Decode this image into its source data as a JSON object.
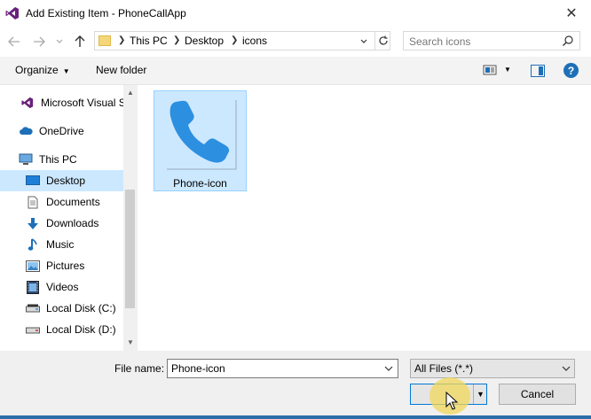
{
  "window": {
    "title": "Add Existing Item - PhoneCallApp",
    "close_glyph": "✕"
  },
  "address": {
    "crumbs": [
      "This PC",
      "Desktop",
      "icons"
    ],
    "search_placeholder": "Search icons"
  },
  "toolbar": {
    "organize_label": "Organize",
    "new_folder_label": "New folder",
    "help_label": "?"
  },
  "nav": {
    "items": [
      {
        "label": "Microsoft Visual S",
        "icon": "visual-studio-icon"
      },
      {
        "label": "OneDrive",
        "icon": "cloud-icon"
      },
      {
        "label": "This PC",
        "icon": "computer-icon"
      },
      {
        "label": "Desktop",
        "icon": "desktop-icon",
        "selected": true
      },
      {
        "label": "Documents",
        "icon": "document-icon"
      },
      {
        "label": "Downloads",
        "icon": "download-icon"
      },
      {
        "label": "Music",
        "icon": "music-icon"
      },
      {
        "label": "Pictures",
        "icon": "picture-icon"
      },
      {
        "label": "Videos",
        "icon": "video-icon"
      },
      {
        "label": "Local Disk (C:)",
        "icon": "drive-icon"
      },
      {
        "label": "Local Disk (D:)",
        "icon": "drive-icon"
      }
    ]
  },
  "files": [
    {
      "name": "Phone-icon",
      "icon": "phone-icon",
      "selected": true
    }
  ],
  "bottom": {
    "file_name_label": "File name:",
    "file_name_value": "Phone-icon",
    "file_type_value": "All Files (*.*)",
    "open_label": "",
    "cancel_label": "Cancel"
  },
  "colors": {
    "accent": "#1e6fb8",
    "selection": "#cce8ff",
    "phone_blue": "#2d8fe0"
  }
}
